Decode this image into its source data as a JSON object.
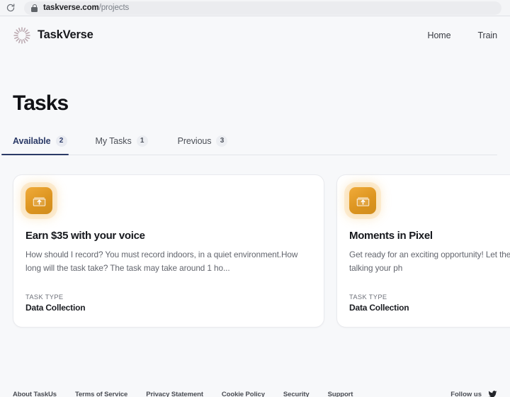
{
  "browser": {
    "reload_icon": "reload-icon",
    "lock_icon": "lock-icon",
    "url_host": "taskverse.com",
    "url_path": "/projects"
  },
  "header": {
    "logo_icon": "taskverse-logo-icon",
    "brand_name": "TaskVerse",
    "nav": [
      {
        "label": "Home"
      },
      {
        "label": "Train"
      }
    ]
  },
  "page": {
    "title": "Tasks"
  },
  "tabs": [
    {
      "label": "Available",
      "badge": "2",
      "active": true
    },
    {
      "label": "My Tasks",
      "badge": "1",
      "active": false
    },
    {
      "label": "Previous",
      "badge": "3",
      "active": false
    }
  ],
  "cards": [
    {
      "icon": "folder-upload-icon",
      "title": "Earn $35 with your voice",
      "description": "How should I record? You must record indoors, in a quiet environment.How long will the task take? The task may take around 1 ho...",
      "meta_label": "TASK TYPE",
      "meta_value": "Data Collection"
    },
    {
      "icon": "folder-upload-icon",
      "title": "Moments in Pixel",
      "description": "Get ready for an exciting opportunity! Let the roll shine – that's right, we're talking your ph",
      "meta_label": "TASK TYPE",
      "meta_value": "Data Collection"
    }
  ],
  "footer": {
    "links": [
      {
        "label": "About TaskUs"
      },
      {
        "label": "Terms of Service"
      },
      {
        "label": "Privacy Statement"
      },
      {
        "label": "Cookie Policy"
      },
      {
        "label": "Security"
      },
      {
        "label": "Support"
      }
    ],
    "follow_label": "Follow us",
    "social_icon": "twitter-icon"
  },
  "colors": {
    "page_background": "#f7f8fa",
    "card_background": "#ffffff",
    "accent_navy": "#2b3a67",
    "icon_orange": "#dd9520",
    "text_primary": "#16181d",
    "text_muted": "#63666e"
  }
}
